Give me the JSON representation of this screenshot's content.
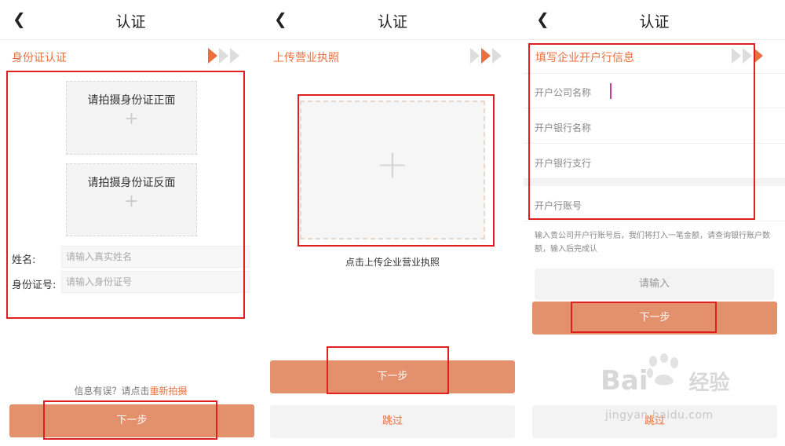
{
  "panels": [
    {
      "title": "认证",
      "section": "身份证认证",
      "photo_front": "请拍摄身份证正面",
      "photo_back": "请拍摄身份证反面",
      "plus": "+",
      "name_label": "姓名:",
      "name_placeholder": "请输入真实姓名",
      "id_label": "身份证号:",
      "id_placeholder": "请输入身份证号",
      "retake_prefix": "信息有误？请点击",
      "retake_link": "重新拍摄",
      "next": "下一步",
      "step": 1
    },
    {
      "title": "认证",
      "section": "上传营业执照",
      "upload_plus": "+",
      "upload_caption": "点击上传企业营业执照",
      "next": "下一步",
      "skip": "跳过",
      "step": 2
    },
    {
      "title": "认证",
      "section": "填写企业开户行信息",
      "company_name": "开户公司名称",
      "bank_name": "开户银行名称",
      "bank_branch": "开户银行支行",
      "account_no": "开户行账号",
      "hint": "输入贵公司开户行账号后，我们将打入一笔金额，请查询银行账户数额，输入后完成认",
      "amount_placeholder": "请输入",
      "next": "下一步",
      "skip": "跳过",
      "step": 3
    }
  ],
  "back_icon": "chevron-left-icon",
  "colors": {
    "accent": "#e8703f",
    "button": "#e3906d",
    "highlight": "#e02020"
  },
  "watermark": {
    "brand": "Bai",
    "brand2": "经验",
    "url": "jingyan.baidu.com"
  }
}
